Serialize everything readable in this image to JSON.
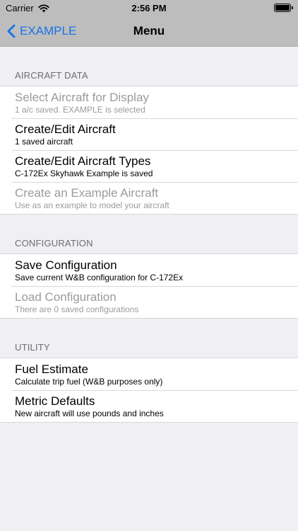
{
  "status_bar": {
    "carrier": "Carrier",
    "time": "2:56 PM",
    "icons": [
      "wifi-icon",
      "battery-icon"
    ]
  },
  "nav": {
    "back_label": "EXAMPLE",
    "title": "Menu",
    "accent_color": "#1a73e8"
  },
  "sections": {
    "aircraft": {
      "header": "AIRCRAFT DATA",
      "rows": [
        {
          "title": "Select Aircraft for Display",
          "subtitle": "1 a/c saved. EXAMPLE is selected",
          "enabled": false
        },
        {
          "title": "Create/Edit Aircraft",
          "subtitle": "1 saved aircraft",
          "enabled": true
        },
        {
          "title": "Create/Edit Aircraft Types",
          "subtitle": "C-172Ex Skyhawk Example is saved",
          "enabled": true
        },
        {
          "title": "Create an Example Aircraft",
          "subtitle": "Use as an example to model your aircraft",
          "enabled": false
        }
      ]
    },
    "configuration": {
      "header": "CONFIGURATION",
      "rows": [
        {
          "title": "Save Configuration",
          "subtitle": "Save current W&B configuration for C-172Ex",
          "enabled": true
        },
        {
          "title": "Load Configuration",
          "subtitle": "There are 0 saved configurations",
          "enabled": false
        }
      ]
    },
    "utility": {
      "header": "UTILITY",
      "rows": [
        {
          "title": "Fuel Estimate",
          "subtitle": "Calculate trip fuel (W&B purposes only)",
          "enabled": true
        },
        {
          "title": "Metric Defaults",
          "subtitle": "New aircraft will use pounds and inches",
          "enabled": true
        }
      ]
    }
  }
}
